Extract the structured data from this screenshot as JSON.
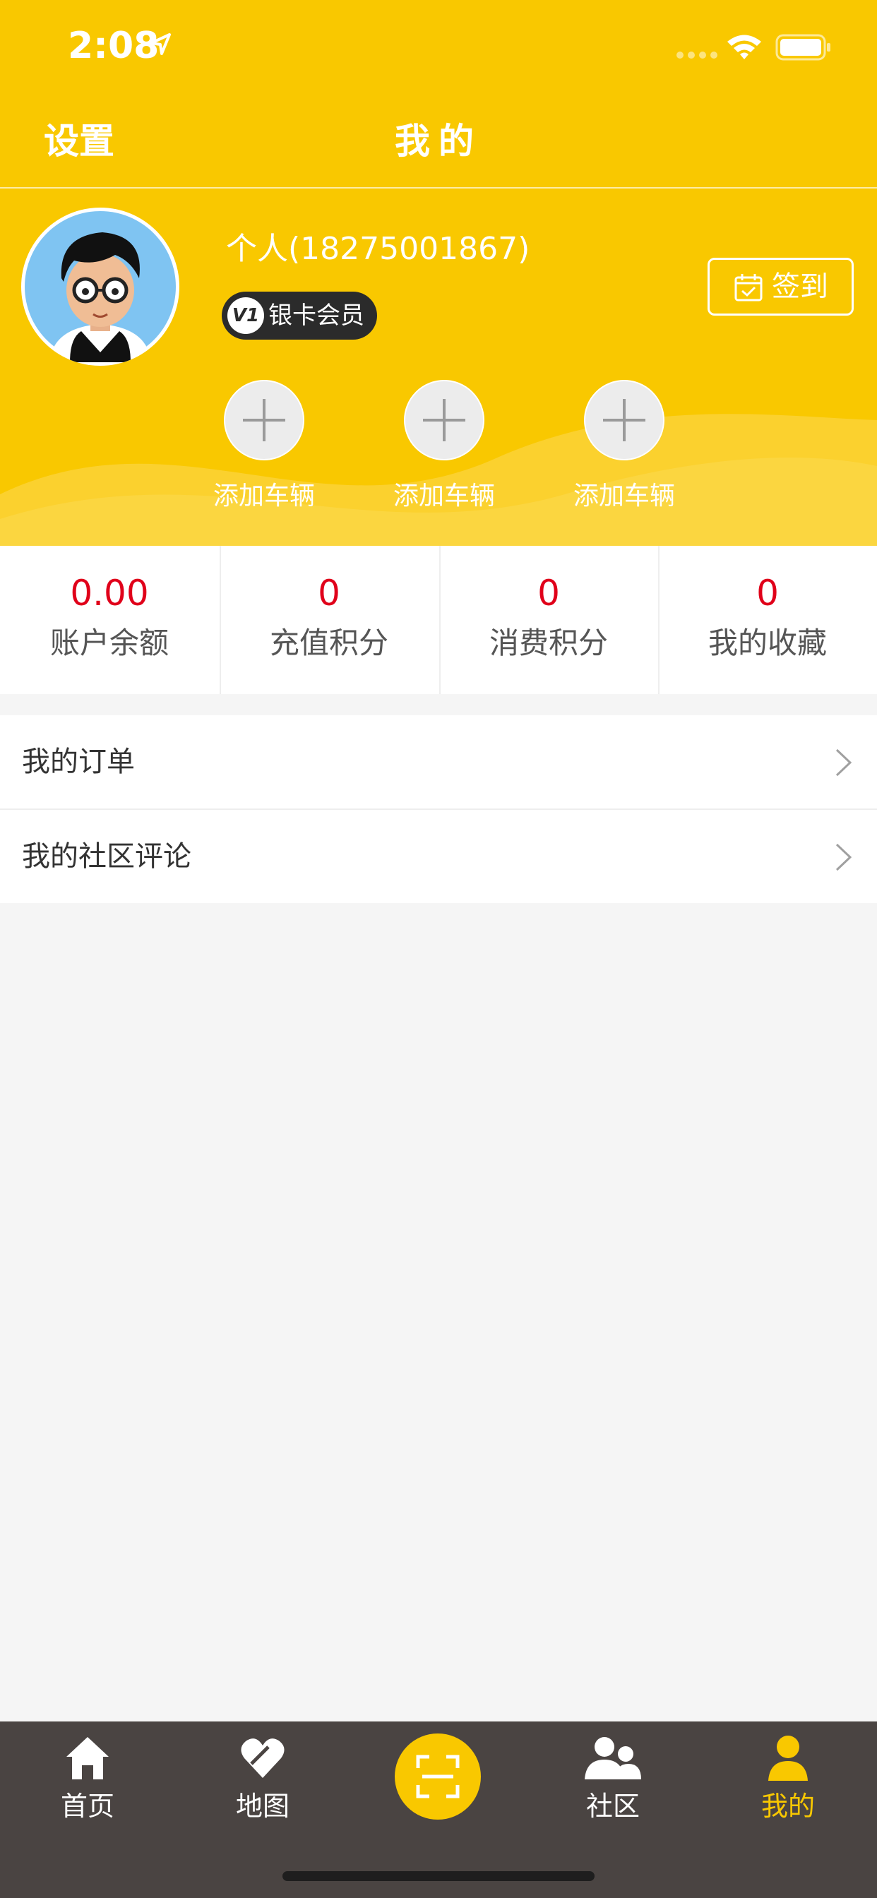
{
  "status_bar": {
    "time": "2:08"
  },
  "nav": {
    "settings_label": "设置",
    "title": "我的"
  },
  "profile": {
    "name": "个人(18275001867)",
    "member_level_icon": "V1",
    "member_level": "银卡会员",
    "checkin_label": "签到"
  },
  "vehicles": [
    {
      "label": "添加车辆"
    },
    {
      "label": "添加车辆"
    },
    {
      "label": "添加车辆"
    }
  ],
  "stats": [
    {
      "value": "0.00",
      "label": "账户余额"
    },
    {
      "value": "0",
      "label": "充值积分"
    },
    {
      "value": "0",
      "label": "消费积分"
    },
    {
      "value": "0",
      "label": "我的收藏"
    }
  ],
  "menu": [
    {
      "label": "我的订单"
    },
    {
      "label": "我的社区评论"
    }
  ],
  "tab_bar": {
    "tabs": [
      {
        "label": "首页",
        "icon": "home-icon"
      },
      {
        "label": "地图",
        "icon": "heart-icon"
      },
      {
        "label": "",
        "icon": "scan-icon"
      },
      {
        "label": "社区",
        "icon": "community-icon"
      },
      {
        "label": "我的",
        "icon": "profile-icon"
      }
    ],
    "active_tab": "我的"
  },
  "colors": {
    "brand_yellow": "#f9c800",
    "value_red": "#e0001a",
    "tab_bar_bg": "#4a4442",
    "page_bg": "#f5f5f5"
  }
}
